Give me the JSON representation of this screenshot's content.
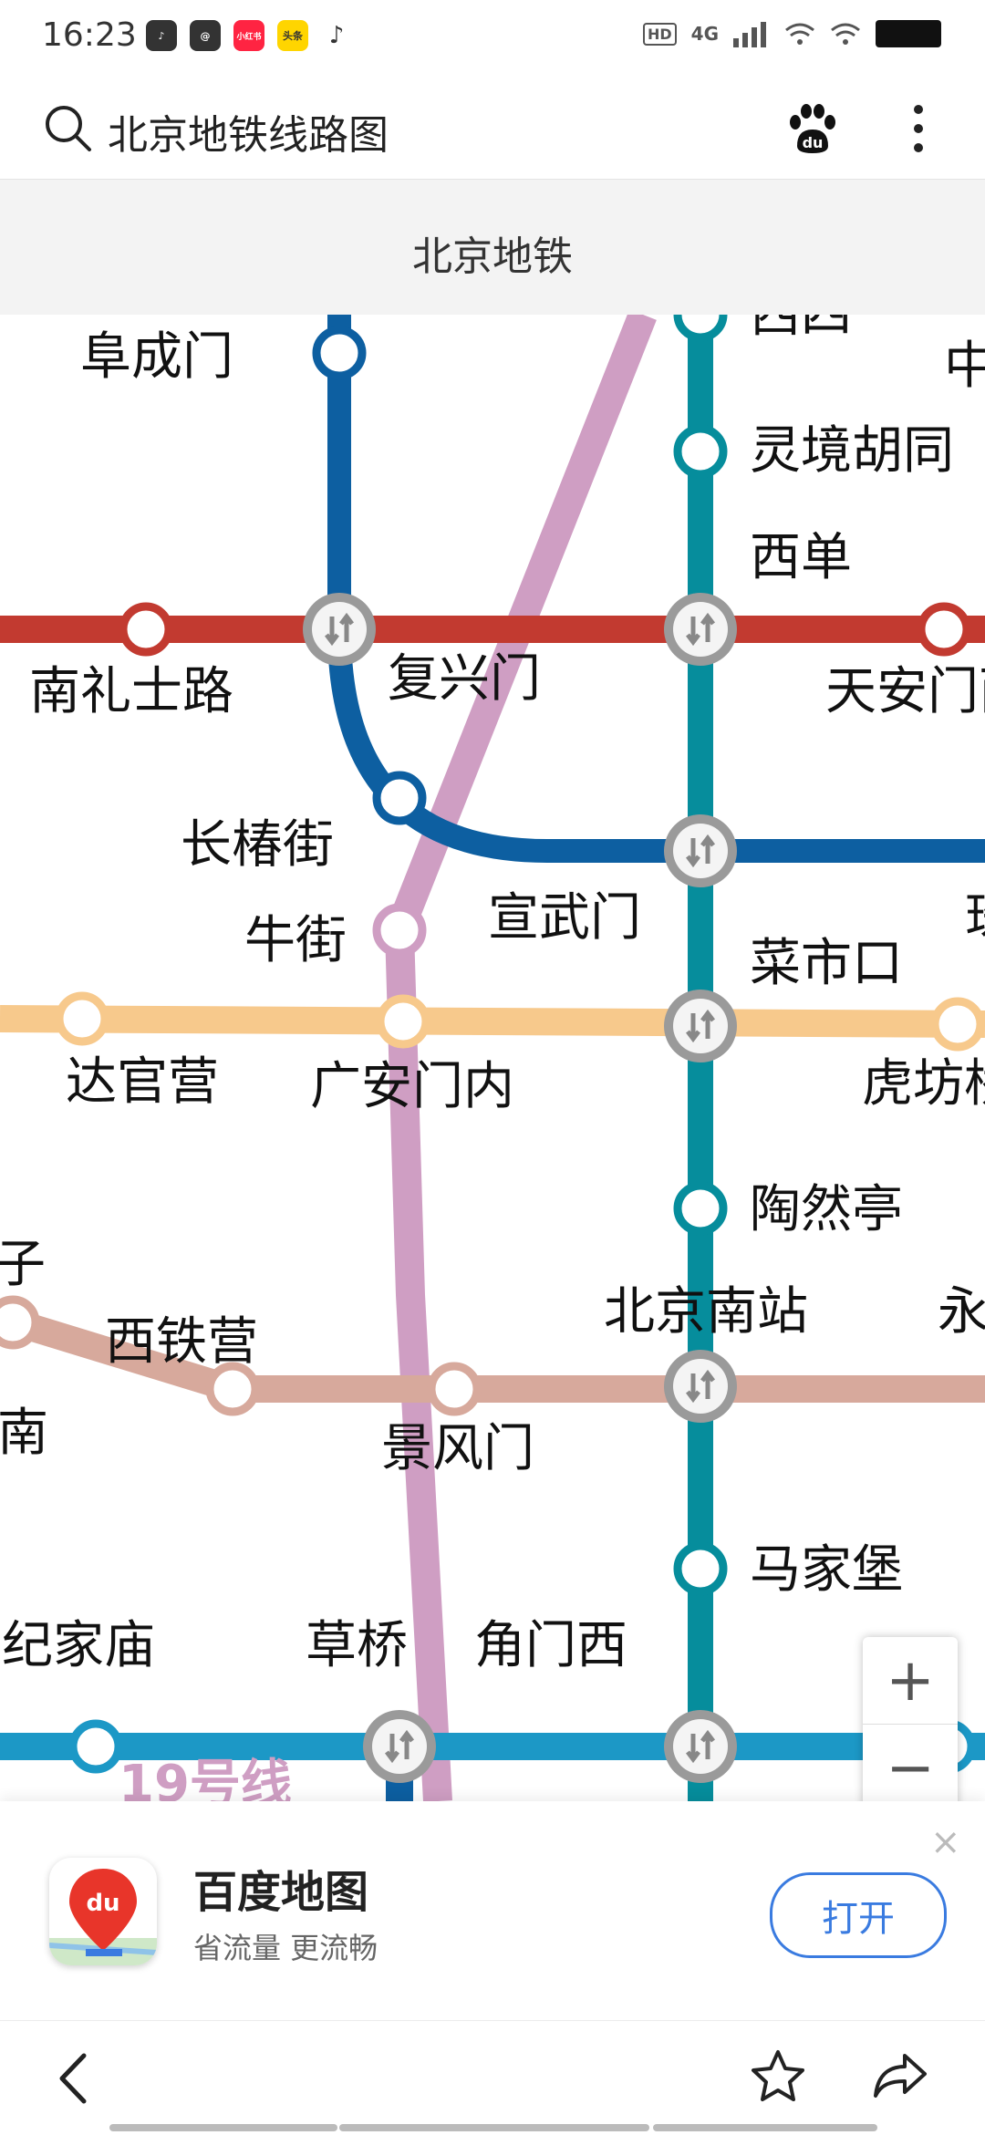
{
  "status_bar": {
    "time": "16:23",
    "apps": [
      {
        "name": "music-app-icon",
        "label": "",
        "bg": "#333333",
        "fg": "#ffffff"
      },
      {
        "name": "message-app-icon",
        "label": "",
        "bg": "#333333",
        "fg": "#ffffff"
      },
      {
        "name": "xiaohongshu-app-icon",
        "label": "小红书",
        "bg": "#ff2442",
        "fg": "#ffffff"
      },
      {
        "name": "news-app-icon",
        "label": "头条",
        "bg": "#ffd500",
        "fg": "#333333"
      },
      {
        "name": "tiktok-app-icon",
        "label": "",
        "bg": "#ffffff",
        "fg": "#333333"
      }
    ],
    "hd_label": "HD",
    "network_label": "4G"
  },
  "search": {
    "query": "北京地铁线路图"
  },
  "page_title": "北京地铁",
  "map": {
    "stations": [
      {
        "name": "阜成门"
      },
      {
        "name": "西四"
      },
      {
        "name": "灵境胡同"
      },
      {
        "name": "西单"
      },
      {
        "name": "南礼士路"
      },
      {
        "name": "复兴门"
      },
      {
        "name": "天安门西"
      },
      {
        "name": "长椿街"
      },
      {
        "name": "宣武门"
      },
      {
        "name": "牛街"
      },
      {
        "name": "菜市口"
      },
      {
        "name": "达官营"
      },
      {
        "name": "广安门内"
      },
      {
        "name": "虎坊桥"
      },
      {
        "name": "陶然亭"
      },
      {
        "name": "北京南站"
      },
      {
        "name": "西铁营"
      },
      {
        "name": "景风门"
      },
      {
        "name": "马家堡"
      },
      {
        "name": "纪家庙"
      },
      {
        "name": "草桥"
      },
      {
        "name": "角门西"
      },
      {
        "name": "湾子"
      },
      {
        "name": "丰台南"
      },
      {
        "name": "永定门外"
      },
      {
        "name": "珠市口"
      },
      {
        "name": "中南海"
      }
    ],
    "line_label": "19号线",
    "colors": {
      "line1": "#c23a30",
      "line2": "#0d5fa1",
      "line4": "#068d9c",
      "line7": "#f7c98c",
      "line14": "#d7a99c",
      "line19": "#cf9ec3",
      "line10": "#1c98c6"
    }
  },
  "zoom": {
    "in": "+",
    "out": "−"
  },
  "banner": {
    "close": "×",
    "app_name": "百度地图",
    "tagline": "省流量 更流畅",
    "open_label": "打开"
  },
  "nav": {}
}
